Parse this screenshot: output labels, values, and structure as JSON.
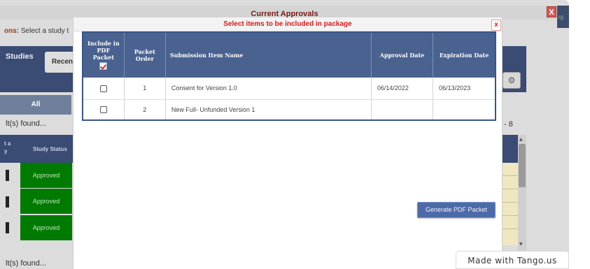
{
  "background": {
    "title": "Current Approvals",
    "close_label": "X",
    "edge_text": "rg",
    "instructions_label": "ons:",
    "instructions_text": "Select a study t",
    "studies_heading": "Studies",
    "recent_tab": "Recen",
    "all_tab": "All",
    "results_found": "lt(s) found...",
    "page_range": "- 8",
    "header_cut": "t a\ny",
    "header_status": "Study Status",
    "rows": [
      {
        "status": "Approved"
      },
      {
        "status": "Approved"
      },
      {
        "status": "Approved"
      }
    ],
    "results_found_bottom": "lt(s) found..."
  },
  "modal": {
    "title": "Select items to be included in package",
    "close_label": "x",
    "columns": {
      "include": "Include in PDF Packet",
      "order": "Packet Order",
      "name": "Submission Item Name",
      "approval": "Approval Date",
      "expiration": "Expiration Date"
    },
    "items": [
      {
        "order": "1",
        "name": "Consent for Version 1.0",
        "approval_date": "06/14/2022",
        "expiration_date": "06/13/2023"
      },
      {
        "order": "2",
        "name": "New Full- Unfunded Version 1",
        "approval_date": "",
        "expiration_date": ""
      }
    ],
    "generate_button": "Generate PDF Packet"
  },
  "watermark": "Made with Tango.us",
  "colors": {
    "header_navy": "#4a6290",
    "approved_green": "#007a00",
    "title_red": "#d11a1a",
    "button_blue": "#4d6aa8"
  }
}
